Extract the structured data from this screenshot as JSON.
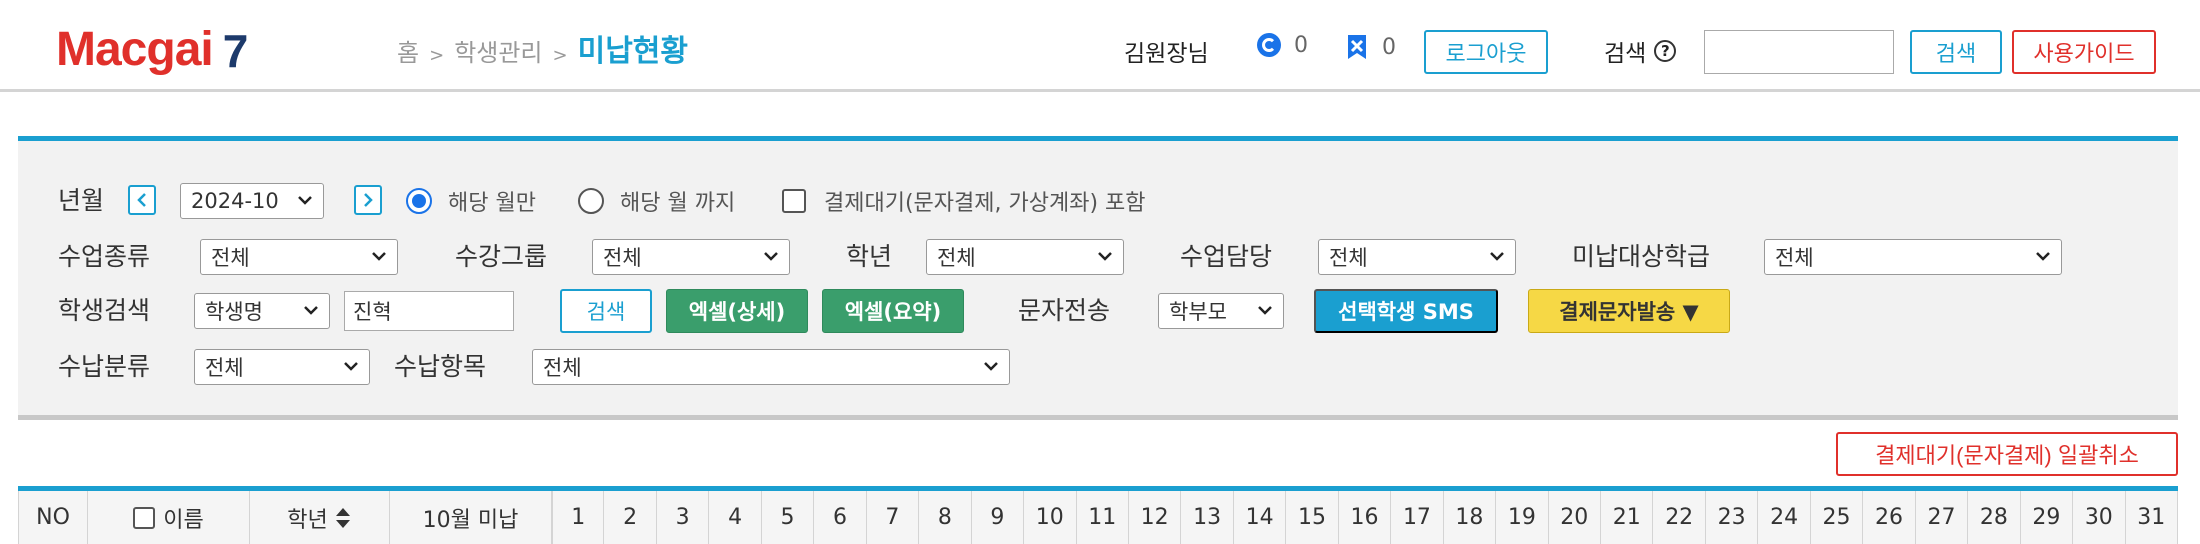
{
  "header": {
    "logo_brand": "Macgai",
    "logo_version": "7",
    "breadcrumb": [
      "홈",
      "학생관리",
      "미납현황"
    ],
    "breadcrumb_sep": ">",
    "user_name": "김원장님",
    "counter_c": "0",
    "counter_x": "0",
    "logout_label": "로그아웃",
    "search_label": "검색",
    "search_help": "?",
    "search_value": "",
    "search_button": "검색",
    "guide_button": "사용가이드"
  },
  "filters": {
    "year_month_label": "년월",
    "year_month_value": "2024-10",
    "radio_month_only": "해당 월만",
    "radio_until_month": "해당 월 까지",
    "include_pending_label": "결제대기(문자결제, 가상계좌) 포함",
    "class_type_label": "수업종류",
    "class_type_value": "전체",
    "group_label": "수강그룹",
    "group_value": "전체",
    "grade_label": "학년",
    "grade_value": "전체",
    "teacher_label": "수업담당",
    "teacher_value": "전체",
    "unpaid_target_label": "미납대상학급",
    "unpaid_target_value": "전체",
    "student_search_label": "학생검색",
    "student_search_field": "학생명",
    "student_search_value": "진혁",
    "search_button": "검색",
    "excel_detail": "엑셀(상세)",
    "excel_summary": "엑셀(요약)",
    "sms_label": "문자전송",
    "sms_target": "학부모",
    "selected_sms": "선택학생 SMS",
    "payment_sms": "결제문자발송 ▼",
    "pay_category_label": "수납분류",
    "pay_category_value": "전체",
    "pay_item_label": "수납항목",
    "pay_item_value": "전체"
  },
  "bulk_cancel_label": "결제대기(문자결제) 일괄취소",
  "table": {
    "no": "NO",
    "name": "이름",
    "grade": "학년",
    "unpaid": "10월 미납",
    "days": [
      "1",
      "2",
      "3",
      "4",
      "5",
      "6",
      "7",
      "8",
      "9",
      "10",
      "11",
      "12",
      "13",
      "14",
      "15",
      "16",
      "17",
      "18",
      "19",
      "20",
      "21",
      "22",
      "23",
      "24",
      "25",
      "26",
      "27",
      "28",
      "29",
      "30",
      "31"
    ]
  },
  "colors": {
    "accent": "#1a9fd0",
    "brand_red": "#e0302b",
    "green": "#3a9e6c",
    "yellow": "#f6d845"
  }
}
